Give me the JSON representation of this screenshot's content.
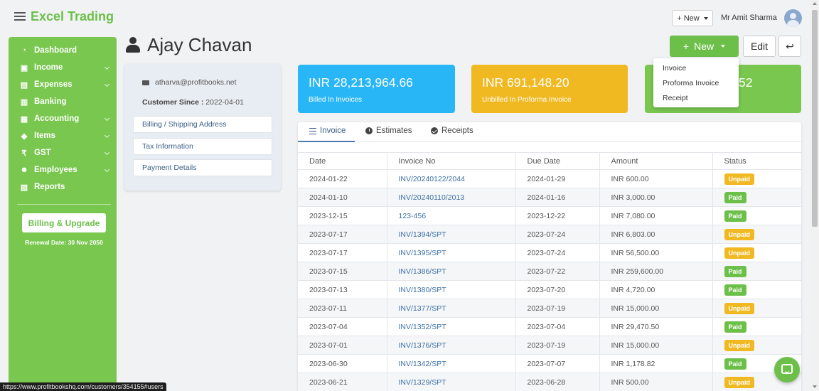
{
  "app": {
    "brand": "Excel Trading",
    "user_name": "Mr Amit Sharma",
    "top_new_label": "+ New"
  },
  "sidebar": {
    "items": [
      {
        "label": "Dashboard",
        "icon": "dashboard-icon",
        "glyph": "◔",
        "has_submenu": false
      },
      {
        "label": "Income",
        "icon": "money-icon",
        "glyph": "▣",
        "has_submenu": true
      },
      {
        "label": "Expenses",
        "icon": "wallet-icon",
        "glyph": "▤",
        "has_submenu": true
      },
      {
        "label": "Banking",
        "icon": "bank-icon",
        "glyph": "▥",
        "has_submenu": false
      },
      {
        "label": "Accounting",
        "icon": "book-icon",
        "glyph": "▦",
        "has_submenu": true
      },
      {
        "label": "Items",
        "icon": "tag-icon",
        "glyph": "◆",
        "has_submenu": true
      },
      {
        "label": "GST",
        "icon": "rupee-icon",
        "glyph": "₹",
        "has_submenu": true
      },
      {
        "label": "Employees",
        "icon": "users-icon",
        "glyph": "☻",
        "has_submenu": true
      },
      {
        "label": "Reports",
        "icon": "chart-icon",
        "glyph": "▨",
        "has_submenu": false
      }
    ],
    "upgrade_label": "Billing & Upgrade",
    "renewal_text": "Renewal Date: 30 Nov 2050"
  },
  "page": {
    "title": "Ajay Chavan",
    "new_label": "New",
    "edit_label": "Edit"
  },
  "customer": {
    "email": "atharva@profitbooks.net",
    "since_label": "Customer Since :",
    "since_value": "2022-04-01",
    "links": [
      "Billing / Shipping Address",
      "Tax Information",
      "Payment Details"
    ]
  },
  "stats": [
    {
      "amount": "INR 28,213,964.66",
      "label": "Billed In Invoices",
      "color": "#29b6f6"
    },
    {
      "amount": "INR 691,148.20",
      "label": "Unbilled In Proforma Invoice",
      "color": "#f0b821"
    },
    {
      "amount": "52",
      "label": "",
      "color": "#7ac74f"
    }
  ],
  "new_dropdown": {
    "items": [
      "Invoice",
      "Proforma Invoice",
      "Receipt"
    ]
  },
  "tabs": [
    {
      "label": "Invoice",
      "active": true
    },
    {
      "label": "Estimates",
      "active": false
    },
    {
      "label": "Receipts",
      "active": false
    }
  ],
  "table": {
    "columns": [
      "Date",
      "Invoice No",
      "Due Date",
      "Amount",
      "Status"
    ],
    "rows": [
      [
        "2024-01-22",
        "INV/20240122/2044",
        "2024-01-29",
        "INR 600.00",
        "Unpaid"
      ],
      [
        "2024-01-10",
        "INV/20240110/2013",
        "2024-01-16",
        "INR 3,000.00",
        "Paid"
      ],
      [
        "2023-12-15",
        "123-456",
        "2023-12-22",
        "INR 7,080.00",
        "Paid"
      ],
      [
        "2023-07-17",
        "INV/1394/SPT",
        "2023-07-24",
        "INR 6,803.00",
        "Unpaid"
      ],
      [
        "2023-07-17",
        "INV/1395/SPT",
        "2023-07-24",
        "INR 56,500.00",
        "Unpaid"
      ],
      [
        "2023-07-15",
        "INV/1386/SPT",
        "2023-07-22",
        "INR 259,600.00",
        "Paid"
      ],
      [
        "2023-07-13",
        "INV/1380/SPT",
        "2023-07-20",
        "INR 4,720.00",
        "Paid"
      ],
      [
        "2023-07-11",
        "INV/1377/SPT",
        "2023-07-19",
        "INR 15,000.00",
        "Unpaid"
      ],
      [
        "2023-07-04",
        "INV/1352/SPT",
        "2023-07-04",
        "INR 29,470.50",
        "Paid"
      ],
      [
        "2023-07-01",
        "INV/1376/SPT",
        "2023-07-19",
        "INR 15,000.00",
        "Unpaid"
      ],
      [
        "2023-06-30",
        "INV/1342/SPT",
        "2023-07-07",
        "INR 1,178.82",
        "Paid"
      ],
      [
        "2023-06-21",
        "INV/1329/SPT",
        "2023-06-28",
        "INR 500.00",
        "Unpaid"
      ]
    ]
  },
  "status_bar": {
    "url": "https://www.profitbookshq.com/customers/354155#users"
  }
}
